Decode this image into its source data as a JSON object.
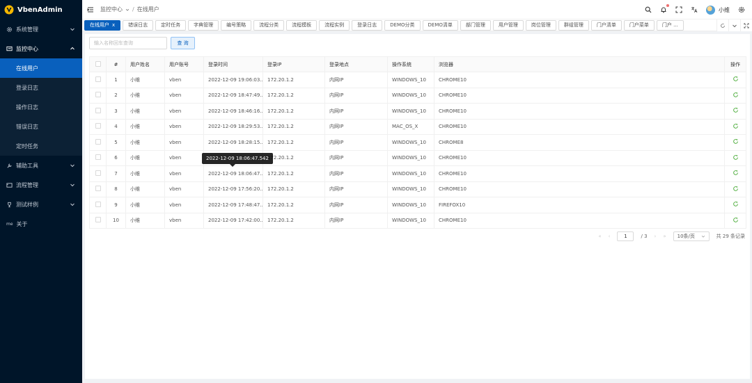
{
  "app": {
    "name": "VbenAdmin"
  },
  "sidebar": {
    "items": [
      {
        "label": "系统管理",
        "icon": "gear-icon",
        "open": false
      },
      {
        "label": "监控中心",
        "icon": "monitor-icon",
        "open": true,
        "children": [
          {
            "label": "在线用户",
            "active": true
          },
          {
            "label": "登录日志"
          },
          {
            "label": "操作日志"
          },
          {
            "label": "错误日志"
          },
          {
            "label": "定时任务"
          }
        ]
      },
      {
        "label": "辅助工具",
        "icon": "tool-icon",
        "open": false
      },
      {
        "label": "流程管理",
        "icon": "flow-icon",
        "open": false
      },
      {
        "label": "测试样例",
        "icon": "trophy-icon",
        "open": false
      },
      {
        "label": "关于",
        "icon": "about-icon",
        "prefix": "me"
      }
    ]
  },
  "header": {
    "breadcrumb": [
      "监控中心",
      "在线用户"
    ],
    "user_name": "小维"
  },
  "tabs": [
    "在线用户",
    "错误日志",
    "定时任务",
    "字典管理",
    "编号策略",
    "流程分类",
    "流程模板",
    "流程实例",
    "登录日志",
    "DEMO分类",
    "DEMO清单",
    "部门管理",
    "用户管理",
    "岗位管理",
    "群组管理",
    "门户清单",
    "门户菜单",
    "门户 ..."
  ],
  "active_tab_close": "x",
  "search": {
    "placeholder": "输入名称回车查询",
    "button_label": "查 询"
  },
  "table": {
    "columns": [
      "#",
      "用户姓名",
      "用户账号",
      "登录时间",
      "登录IP",
      "登录地点",
      "操作系统",
      "浏览器",
      "操作"
    ],
    "rows": [
      [
        "1",
        "小维",
        "vben",
        "2022-12-09 19:06:03...",
        "172.20.1.2",
        "内网IP",
        "WINDOWS_10",
        "CHROME10"
      ],
      [
        "2",
        "小维",
        "vben",
        "2022-12-09 18:47:49...",
        "172.20.1.2",
        "内网IP",
        "WINDOWS_10",
        "CHROME10"
      ],
      [
        "3",
        "小维",
        "vben",
        "2022-12-09 18:46:16...",
        "172.20.1.2",
        "内网IP",
        "WINDOWS_10",
        "CHROME10"
      ],
      [
        "4",
        "小维",
        "vben",
        "2022-12-09 18:29:53...",
        "172.20.1.2",
        "内网IP",
        "MAC_OS_X",
        "CHROME10"
      ],
      [
        "5",
        "小维",
        "vben",
        "2022-12-09 18:28:15...",
        "172.20.1.2",
        "内网IP",
        "WINDOWS_10",
        "CHROME8"
      ],
      [
        "6",
        "小维",
        "vben",
        "",
        "172.20.1.2",
        "内网IP",
        "WINDOWS_10",
        "CHROME10"
      ],
      [
        "7",
        "小维",
        "vben",
        "2022-12-09 18:06:47...",
        "172.20.1.2",
        "内网IP",
        "WINDOWS_10",
        "CHROME10"
      ],
      [
        "8",
        "小维",
        "vben",
        "2022-12-09 17:56:20...",
        "172.20.1.2",
        "内网IP",
        "WINDOWS_10",
        "CHROME10"
      ],
      [
        "9",
        "小维",
        "vben",
        "2022-12-09 17:48:47...",
        "172.20.1.2",
        "内网IP",
        "WINDOWS_10",
        "FIREFOX10"
      ],
      [
        "10",
        "小维",
        "vben",
        "2022-12-09 17:42:00...",
        "172.20.1.2",
        "内网IP",
        "WINDOWS_10",
        "CHROME10"
      ]
    ],
    "tooltip": "2022-12-09 18:06:47.542"
  },
  "pagination": {
    "current": "1",
    "total_pages": "/ 3",
    "page_size": "10条/页",
    "total": "共 29 条记录"
  },
  "colors": {
    "sidebar_bg": "#001529",
    "primary": "#0960bd",
    "refresh_icon": "#55b044"
  }
}
